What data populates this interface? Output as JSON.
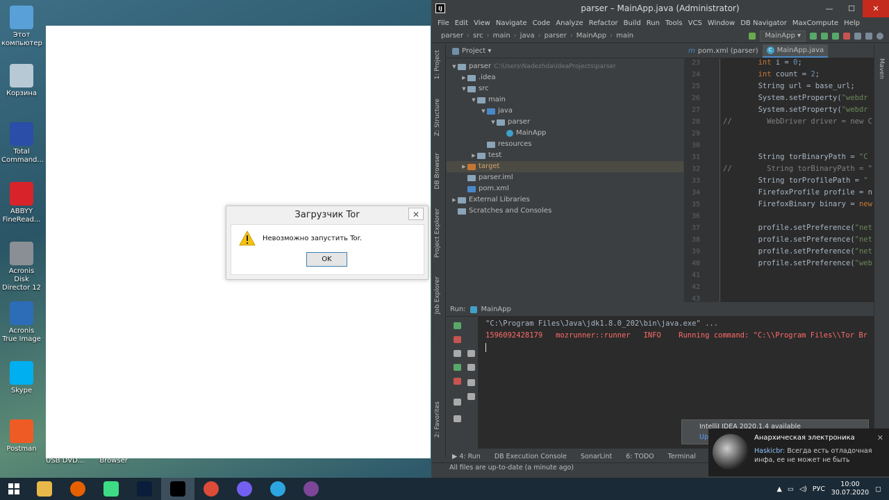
{
  "desktop": {
    "icons": [
      {
        "label": "Этот компьютер",
        "color": "#5aa0d8"
      },
      {
        "label": "Корзина",
        "color": "#b8c9d6"
      },
      {
        "label": "Total Command...",
        "color": "#2b4ea8"
      },
      {
        "label": "ABBYY FineRead...",
        "color": "#d8232a"
      },
      {
        "label": "Acronis Disk Director 12",
        "color": "#8a8f96"
      },
      {
        "label": "Acronis True Image",
        "color": "#2d6cb7"
      },
      {
        "label": "Skype",
        "color": "#00aff0"
      },
      {
        "label": "Postman",
        "color": "#ef5b25"
      }
    ],
    "bottom_labels": [
      "USB DVD...",
      "Browser"
    ]
  },
  "dialog": {
    "title": "Загрузчик Tor",
    "close": "✕",
    "message": "Невозможно запустить Tor.",
    "ok": "OK"
  },
  "ide": {
    "title": "parser – MainApp.java (Administrator)",
    "logo": "IJ",
    "win": {
      "minimize": "—",
      "maximize": "☐",
      "close": "✕"
    },
    "menu": [
      "File",
      "Edit",
      "View",
      "Navigate",
      "Code",
      "Analyze",
      "Refactor",
      "Build",
      "Run",
      "Tools",
      "VCS",
      "Window",
      "DB Navigator",
      "MaxCompute",
      "Help"
    ],
    "breadcrumb": [
      "parser",
      "src",
      "main",
      "java",
      "parser",
      "MainApp",
      "main"
    ],
    "run_config": "MainApp ▾",
    "left_tabs": [
      "1: Project",
      "Z: Structure",
      "DB Browser",
      "Project Explorer",
      "Job Explorer",
      "2: Favorites"
    ],
    "right_tabs": [
      "Maven"
    ],
    "project": {
      "header": "Project ▾",
      "tree": [
        {
          "label": "parser",
          "path": "C:\\Users\\Nadezhda\\IdeaProjects\\parser",
          "arrow": "▼",
          "type": "folder",
          "color": "#8aa4b8"
        },
        {
          "label": ".idea",
          "arrow": "▶",
          "type": "folder",
          "color": "#8aa4b8"
        },
        {
          "label": "src",
          "arrow": "▼",
          "type": "folder",
          "color": "#8aa4b8"
        },
        {
          "label": "main",
          "arrow": "▼",
          "type": "folder",
          "color": "#8aa4b8"
        },
        {
          "label": "java",
          "arrow": "▼",
          "type": "folder",
          "color": "#4a88c7"
        },
        {
          "label": "parser",
          "arrow": "▼",
          "type": "folder",
          "color": "#8aa4b8"
        },
        {
          "label": "MainApp",
          "arrow": "",
          "type": "class",
          "color": "#40a0c8"
        },
        {
          "label": "resources",
          "arrow": "",
          "type": "folder",
          "color": "#8aa4b8"
        },
        {
          "label": "test",
          "arrow": "▶",
          "type": "folder",
          "color": "#8aa4b8"
        },
        {
          "label": "target",
          "arrow": "▶",
          "type": "folder",
          "color": "#c57633"
        },
        {
          "label": "parser.iml",
          "arrow": "",
          "type": "file",
          "color": "#8aa4b8"
        },
        {
          "label": "pom.xml",
          "arrow": "",
          "type": "maven",
          "color": "#4a88c7"
        },
        {
          "label": "External Libraries",
          "arrow": "▶",
          "type": "lib",
          "color": "#8aa4b8"
        },
        {
          "label": "Scratches and Consoles",
          "arrow": "",
          "type": "scratch",
          "color": "#8aa4b8"
        }
      ]
    },
    "tabs": [
      {
        "label": "pom.xml (parser)",
        "icon": "m"
      },
      {
        "label": "MainApp.java",
        "icon": "C"
      }
    ],
    "code": [
      {
        "n": "23",
        "html": "        <span class=\"kw\">int</span> i = <span class=\"num\">0</span>;"
      },
      {
        "n": "24",
        "html": "        <span class=\"kw\">int</span> count = <span class=\"num\">2</span>;"
      },
      {
        "n": "25",
        "html": "        String url = base_url;"
      },
      {
        "n": "26",
        "html": "        System.setProperty(<span class=\"str\">\"webdr</span>"
      },
      {
        "n": "27",
        "html": "        System.setProperty(<span class=\"str\">\"webdr</span>"
      },
      {
        "n": "28",
        "html": "<span class=\"cmt\">//        WebDriver driver = new C</span>"
      },
      {
        "n": "29",
        "html": ""
      },
      {
        "n": "30",
        "html": ""
      },
      {
        "n": "31",
        "html": "        String torBinaryPath = <span class=\"str\">\"C</span>"
      },
      {
        "n": "32",
        "html": "<span class=\"cmt\">//        String torBinaryPath = \"</span>"
      },
      {
        "n": "33",
        "html": "        String torProfilePath = <span class=\"str\">\"</span>"
      },
      {
        "n": "34",
        "html": "        FirefoxProfile profile = n"
      },
      {
        "n": "35",
        "html": "        FirefoxBinary binary = <span class=\"kw\">new</span>"
      },
      {
        "n": "36",
        "html": ""
      },
      {
        "n": "37",
        "html": "        profile.setPreference(<span class=\"str\">\"net</span>"
      },
      {
        "n": "38",
        "html": "        profile.setPreference(<span class=\"str\">\"net</span>"
      },
      {
        "n": "39",
        "html": "        profile.setPreference(<span class=\"str\">\"net</span>"
      },
      {
        "n": "40",
        "html": "        profile.setPreference(<span class=\"str\">\"web</span>"
      },
      {
        "n": "41",
        "html": ""
      },
      {
        "n": "42",
        "html": ""
      },
      {
        "n": "43",
        "html": ""
      }
    ],
    "run": {
      "label": "Run:",
      "tab": "MainApp",
      "console": [
        {
          "cls": "c-cmd",
          "text": "\"C:\\Program Files\\Java\\jdk1.8.0_202\\bin\\java.exe\" ..."
        },
        {
          "cls": "c-err",
          "text": "1596092428179   mozrunner::runner   INFO    Running command: \"C:\\\\Program Files\\\\Tor Br"
        }
      ]
    },
    "bottom_tabs": [
      "▶ 4: Run",
      "DB Execution Console",
      "SonarLint",
      "6: TODO",
      "Terminal"
    ],
    "status": "All files are up-to-date (a minute ago)",
    "notification": {
      "title": "IntelliJ IDEA 2020.1.4 available",
      "link": "Up"
    }
  },
  "toast": {
    "title": "Анархическая электроника",
    "sender": "Haskicbr:",
    "message": "Всегда есть отладочная инфа, ее не может не быть",
    "close": "✕"
  },
  "taskbar": {
    "apps": [
      {
        "name": "file-explorer",
        "color": "#e8b84a"
      },
      {
        "name": "firefox",
        "color": "#e66000"
      },
      {
        "name": "android-studio",
        "color": "#3ddc84"
      },
      {
        "name": "photoshop",
        "color": "#0a1e3c"
      },
      {
        "name": "intellij",
        "color": "#000000"
      },
      {
        "name": "chrome",
        "color": "#dd4b39"
      },
      {
        "name": "viber",
        "color": "#7360f2"
      },
      {
        "name": "telegram",
        "color": "#2ca5e0"
      },
      {
        "name": "tor-browser",
        "color": "#7d4698"
      }
    ],
    "lang": "РУС",
    "time": "10:00",
    "date": "30.07.2020"
  }
}
